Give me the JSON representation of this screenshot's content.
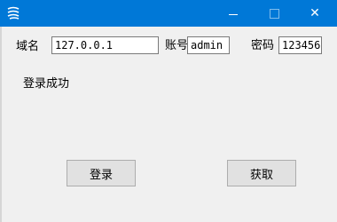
{
  "colors": {
    "titlebar": "#0078d7",
    "window_bg": "#f0f0f0",
    "button_bg": "#e1e1e1"
  },
  "titlebar": {
    "app_icon": "app-logo-icon",
    "minimize_icon": "minimize-icon",
    "maximize_icon": "maximize-icon",
    "close_icon": "close-icon",
    "close_glyph": "✕"
  },
  "form": {
    "domain_label": "域名",
    "domain_value": "127.0.0.1",
    "account_label": "账号",
    "account_value": "admin",
    "password_label": "密码",
    "password_value": "123456"
  },
  "status": {
    "message": "登录成功"
  },
  "buttons": {
    "login_label": "登录",
    "fetch_label": "获取"
  }
}
